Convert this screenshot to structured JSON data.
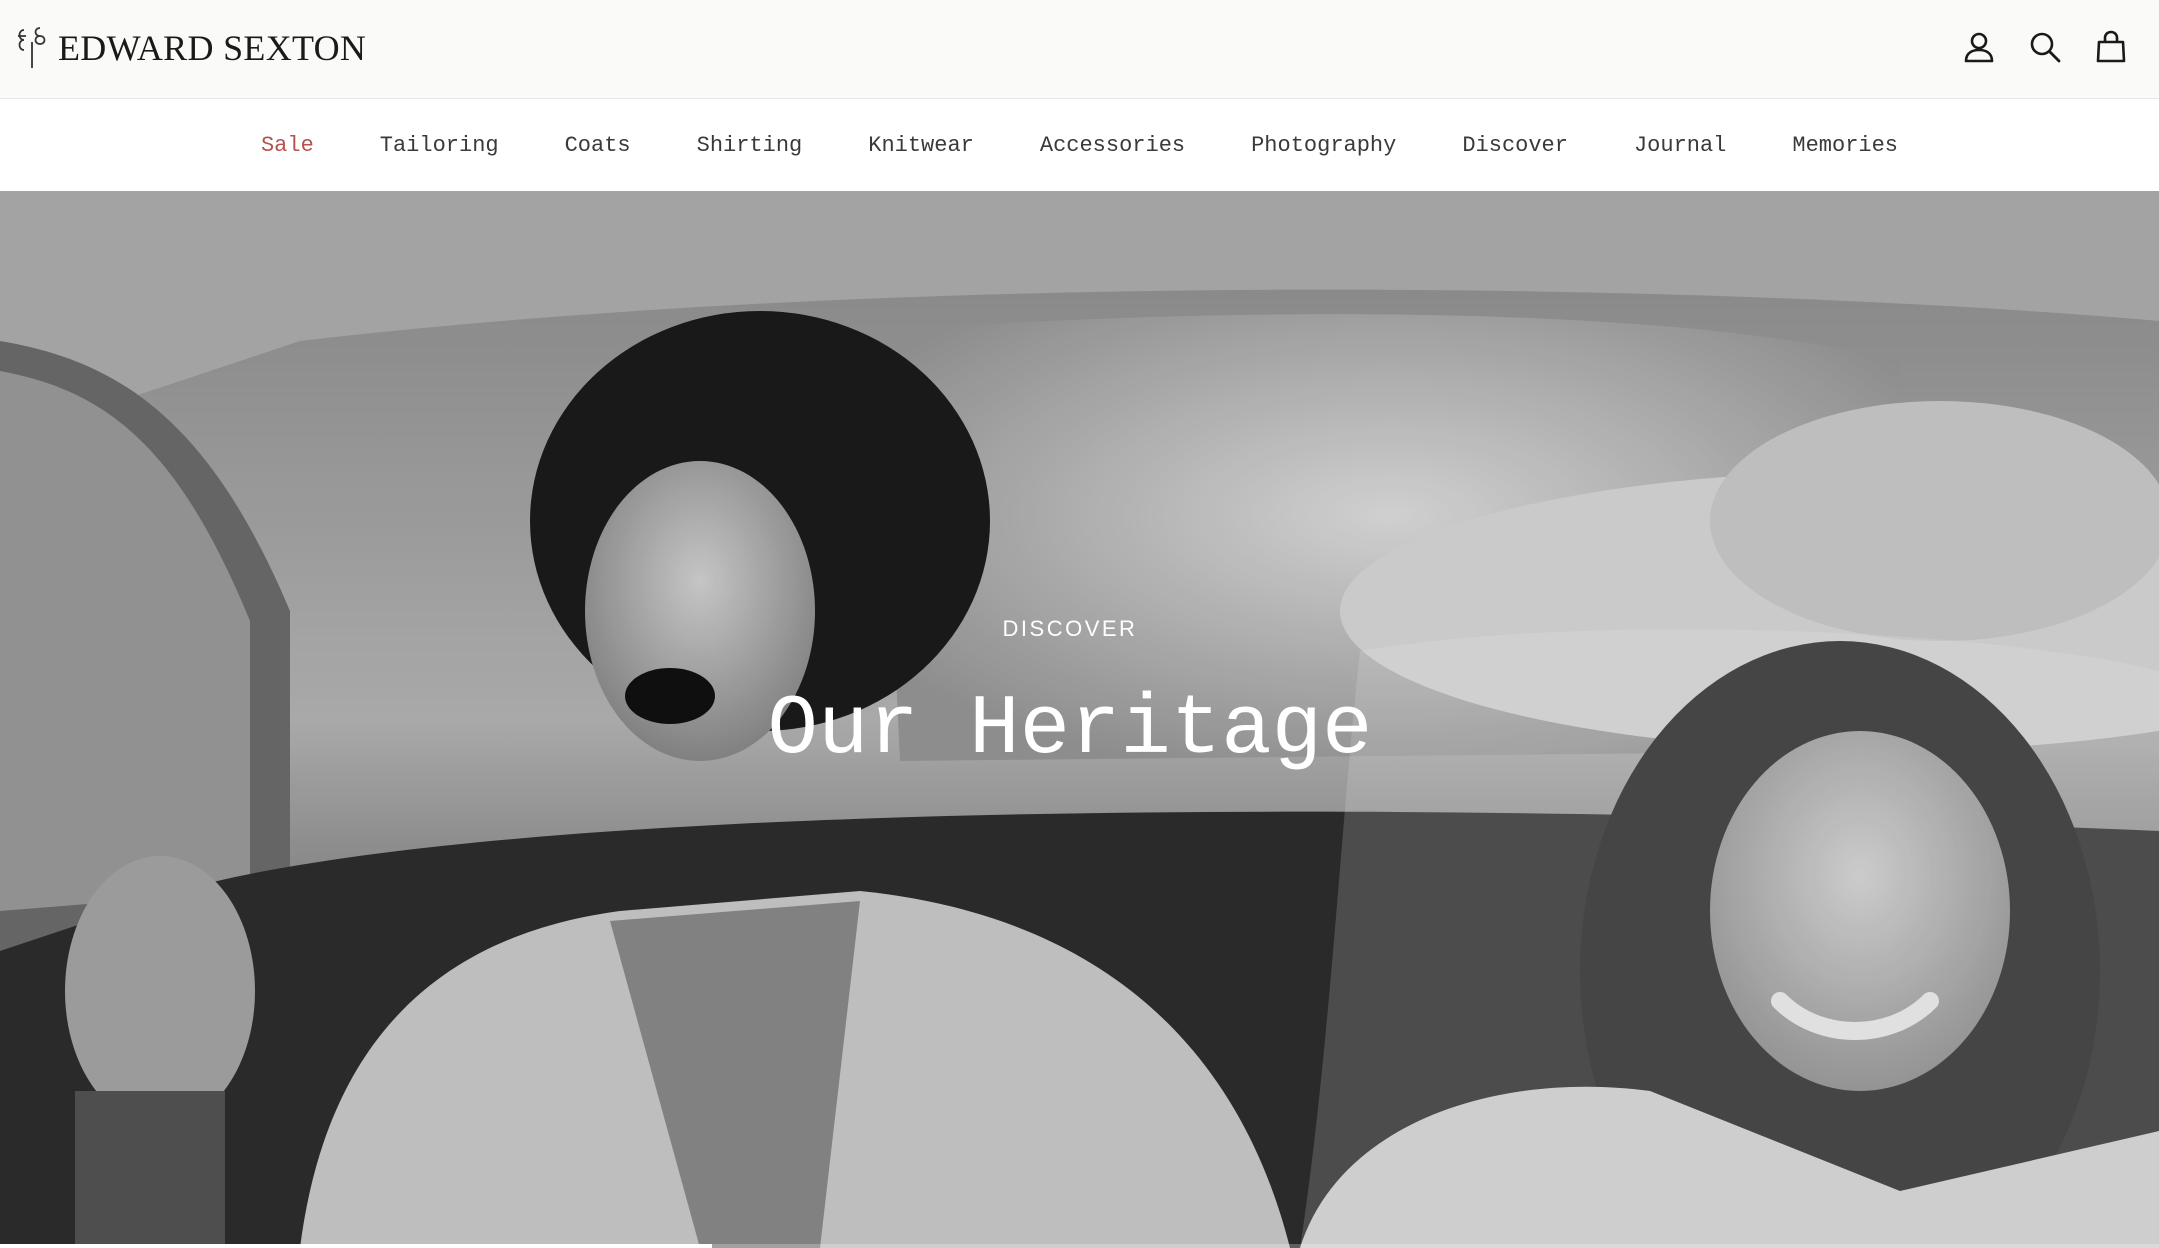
{
  "brand": {
    "name": "EDWARD SEXTON"
  },
  "header": {
    "icons": [
      "account-icon",
      "search-icon",
      "bag-icon"
    ]
  },
  "nav": {
    "items": [
      {
        "label": "Sale"
      },
      {
        "label": "Tailoring"
      },
      {
        "label": "Coats"
      },
      {
        "label": "Shirting"
      },
      {
        "label": "Knitwear"
      },
      {
        "label": "Accessories"
      },
      {
        "label": "Photography"
      },
      {
        "label": "Discover"
      },
      {
        "label": "Journal"
      },
      {
        "label": "Memories"
      }
    ],
    "sale_color": "#b5524c"
  },
  "hero": {
    "eyebrow": "DISCOVER",
    "title": "Our Heritage",
    "slide_progress": 0.33
  }
}
